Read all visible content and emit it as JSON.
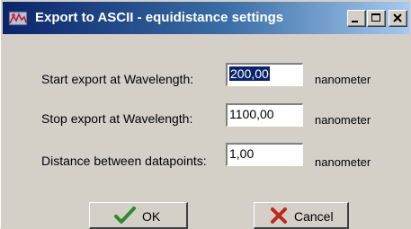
{
  "window": {
    "title": "Export to ASCII - equidistance settings",
    "controls": [
      "minimize-icon",
      "maximize-icon",
      "close-icon"
    ]
  },
  "form": {
    "start": {
      "label": "Start export at Wavelength:",
      "value": "200,00",
      "unit": "nanometer"
    },
    "stop": {
      "label": "Stop export at Wavelength:",
      "value": "1100,00",
      "unit": "nanometer"
    },
    "distance": {
      "label": "Distance between datapoints:",
      "value": "1,00",
      "unit": "nanometer"
    }
  },
  "buttons": {
    "ok": {
      "label": "OK",
      "icon": "checkmark-icon",
      "color": "#2e8b2e"
    },
    "cancel": {
      "label": "Cancel",
      "icon": "cross-icon",
      "color": "#c0281c"
    }
  },
  "colors": {
    "titlebar_start": "#0a246a",
    "titlebar_end": "#a6caf0",
    "face": "#d4d0c8"
  }
}
